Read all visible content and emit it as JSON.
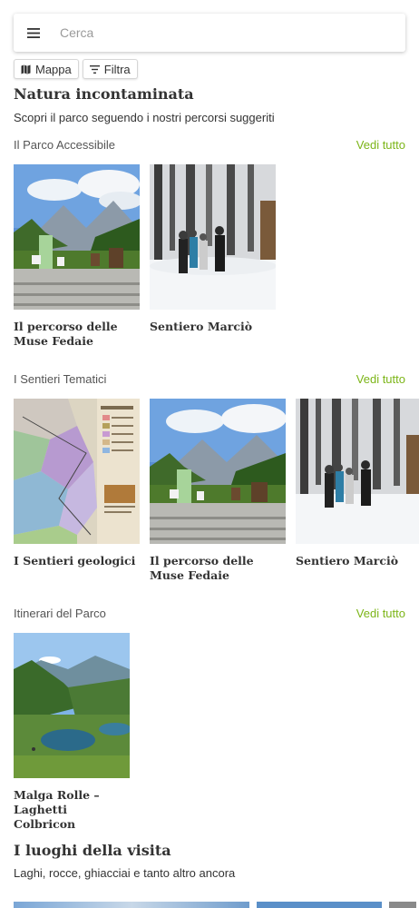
{
  "search": {
    "placeholder": "Cerca",
    "menu_icon": "hamburger-icon"
  },
  "chips": [
    {
      "label": "Mappa",
      "icon": "map-icon"
    },
    {
      "label": "Filtra",
      "icon": "filter-icon"
    }
  ],
  "hero": {
    "title": "Natura incontaminata",
    "subtitle": "Scopri il parco seguendo i nostri percorsi suggeriti"
  },
  "sections": [
    {
      "title": "Il Parco Accessibile",
      "see_all": "Vedi tutto",
      "cards": [
        {
          "title": "Il percorso delle Muse Fedaie",
          "image": "mountain-meadow-sculptures"
        },
        {
          "title": "Sentiero Marciò",
          "image": "snowy-forest-hikers"
        }
      ]
    },
    {
      "title": "I Sentieri Tematici",
      "see_all": "Vedi tutto",
      "cards": [
        {
          "title": "I Sentieri geologici",
          "image": "geological-map"
        },
        {
          "title": "Il percorso delle Muse Fedaie",
          "image": "mountain-meadow-sculptures"
        },
        {
          "title": "Sentiero Marciò",
          "image": "snowy-forest-hikers"
        }
      ]
    },
    {
      "title": "Itinerari del Parco",
      "see_all": "Vedi tutto",
      "cards": [
        {
          "title": "Malga Rolle – Laghetti Colbricon",
          "image": "alpine-lake"
        }
      ]
    }
  ],
  "places": {
    "title": "I luoghi della visita",
    "subtitle": "Laghi, rocce, ghiacciai e tanto altro ancora"
  },
  "colors": {
    "accent": "#7cb518",
    "text": "#333333"
  }
}
